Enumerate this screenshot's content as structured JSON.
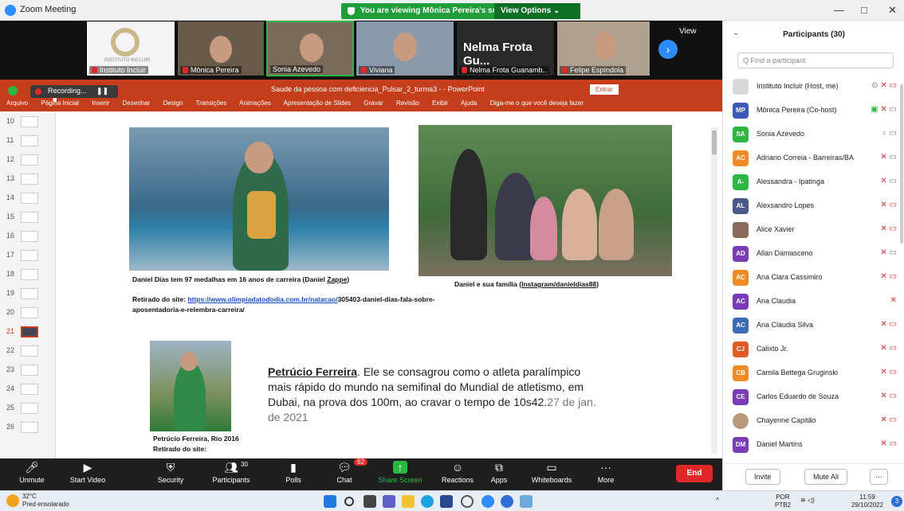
{
  "window": {
    "title": "Zoom Meeting",
    "banner_text": "You are viewing Mônica Pereira's screen",
    "view_options": "View Options ⌄",
    "minimize": "—",
    "maximize": "□",
    "close": "✕"
  },
  "video_strip": {
    "tiles": [
      {
        "name": "Instituto Incluir"
      },
      {
        "name": "Mônica Pereira"
      },
      {
        "name": "Sonia Azevedo"
      },
      {
        "name": "Viviana"
      },
      {
        "name": "Nelma Frota Guanamb..",
        "big": "Nelma Frota Gu..."
      },
      {
        "name": "Felipe Espíndola"
      }
    ],
    "view_label": "View",
    "next_icon": "›",
    "logo_text": "INSTITUTO INCLUIR"
  },
  "recording": {
    "label": "Recording...",
    "pause": "❚❚",
    "stop": "■"
  },
  "powerpoint": {
    "doc_title": "Saude da pessoa com deficiencia_Pulsar_2_turma3 -  - PowerPoint",
    "entrar": "Entrar",
    "menu": [
      "Arquivo",
      "Página Inicial",
      "Inserir",
      "Desenhar",
      "Design",
      "Transições",
      "Animações",
      "Apresentação de Slides",
      "Gravar",
      "Revisão",
      "Exibir",
      "Ajuda",
      "Diga-me o que você deseja fazer"
    ],
    "slide_numbers": [
      "10",
      "11",
      "12",
      "13",
      "14",
      "15",
      "16",
      "17",
      "18",
      "19",
      "20",
      "21",
      "22",
      "23",
      "24",
      "25",
      "26"
    ],
    "selected_slide": "21",
    "caption1_pre": "Daniel Dias tem 97 medalhas em 16 anos de carreira (Daniel ",
    "caption1_u": "Zappe",
    "caption1_post": ")",
    "caption2_pre": "Daniel e sua família (",
    "caption2_u": "Instagram/danieldias88",
    "caption2_post": ")",
    "source_label": "Retirado do site: ",
    "source_link": "https://www.olimpiadatododia.com.br/natacao/",
    "source_rest": "305403-daniel-dias-fala-sobre-",
    "source_rest2": "aposentadoria-e-relembra-carreira/",
    "petrucio_name": "Petrúcio Ferreira",
    "petrucio_text": ". Ele se consagrou como o atleta paralímpico mais rápido do mundo na semifinal do Mundial de atletismo, em Dubai, na prova dos 100m, ao cravar o tempo de 10s42.",
    "petrucio_date": "27 de jan. de 2021",
    "petrucio_cap1": "Petrúcio Ferreira, Rio 2016",
    "petrucio_cap2": "Retirado do site:"
  },
  "toolbar": {
    "unmute": "Unmute",
    "start_video": "Start Video",
    "security": "Security",
    "participants": "Participants",
    "participants_count": "30",
    "polls": "Polls",
    "chat": "Chat",
    "chat_badge": "62",
    "share_screen": "Share Screen",
    "reactions": "Reactions",
    "apps": "Apps",
    "whiteboards": "Whiteboards",
    "more": "More",
    "end": "End"
  },
  "participants": {
    "title": "Participants (30)",
    "search_placeholder": "Find a participant",
    "list": [
      {
        "initials": "",
        "name": "Instituto Incluir (Host, me)",
        "color": "#d8d8d8"
      },
      {
        "initials": "MP",
        "name": "Mônica Pereira (Co-host)",
        "color": "#3b5bb8"
      },
      {
        "initials": "SA",
        "name": "Sonia Azevedo",
        "color": "#2db742"
      },
      {
        "initials": "AC",
        "name": "Adriano Correia - Barreiras/BA",
        "color": "#f08a24"
      },
      {
        "initials": "A-",
        "name": "Alessandra - Ipatinga",
        "color": "#2db742"
      },
      {
        "initials": "AL",
        "name": "Alexsandro Lopes",
        "color": "#4a5a8a"
      },
      {
        "initials": "",
        "name": "Alice Xavier",
        "color": "#8a6a5a"
      },
      {
        "initials": "AD",
        "name": "Allan Damasceno",
        "color": "#7a3bb8"
      },
      {
        "initials": "AC",
        "name": "Ana Clara Cassimiro",
        "color": "#f08a24"
      },
      {
        "initials": "AC",
        "name": "Ana Claudia",
        "color": "#7a3bb8"
      },
      {
        "initials": "AC",
        "name": "Ana Claudia Silva",
        "color": "#3b6ab8"
      },
      {
        "initials": "CJ",
        "name": "Calixto Jr.",
        "color": "#e05a24"
      },
      {
        "initials": "CB",
        "name": "Camila Bettega Gruginski",
        "color": "#f08a24"
      },
      {
        "initials": "CE",
        "name": "Carlos Eduardo de Souza",
        "color": "#7a3bb8"
      },
      {
        "initials": "",
        "name": "Chayenne Capitão",
        "color": "#b89a7a"
      },
      {
        "initials": "DM",
        "name": "Daniel Martins",
        "color": "#7a3bb8"
      }
    ],
    "invite": "Invite",
    "mute_all": "Mute All",
    "more": "···"
  },
  "taskbar": {
    "temp": "32°C",
    "weather": "Pred ensolarado",
    "lang1": "POR",
    "lang2": "PTB2",
    "time": "11:59",
    "date": "29/10/2022",
    "notifications": "3"
  }
}
